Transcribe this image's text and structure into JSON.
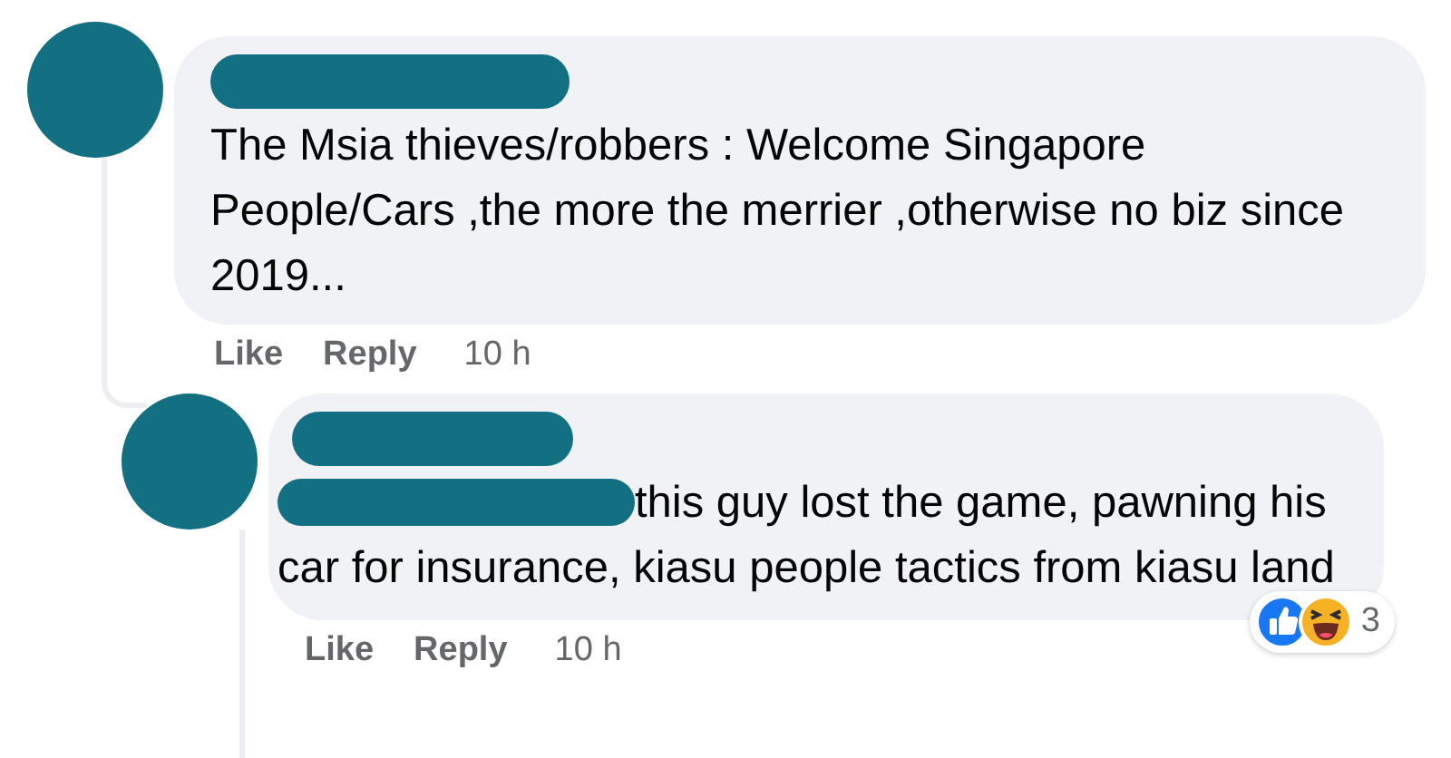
{
  "comments": [
    {
      "text": "The Msia thieves/robbers : Welcome Singapore People/Cars ,the more the merrier ,otherwise no biz since 2019...",
      "actions": [
        "Like",
        "Reply"
      ],
      "time": "10 h",
      "replies": [
        {
          "text": "this guy lost the game, pawning his car for insurance, kiasu people tactics from kiasu land",
          "actions": [
            "Like",
            "Reply"
          ],
          "time": "10 h",
          "reaction_count": "3"
        }
      ]
    }
  ]
}
